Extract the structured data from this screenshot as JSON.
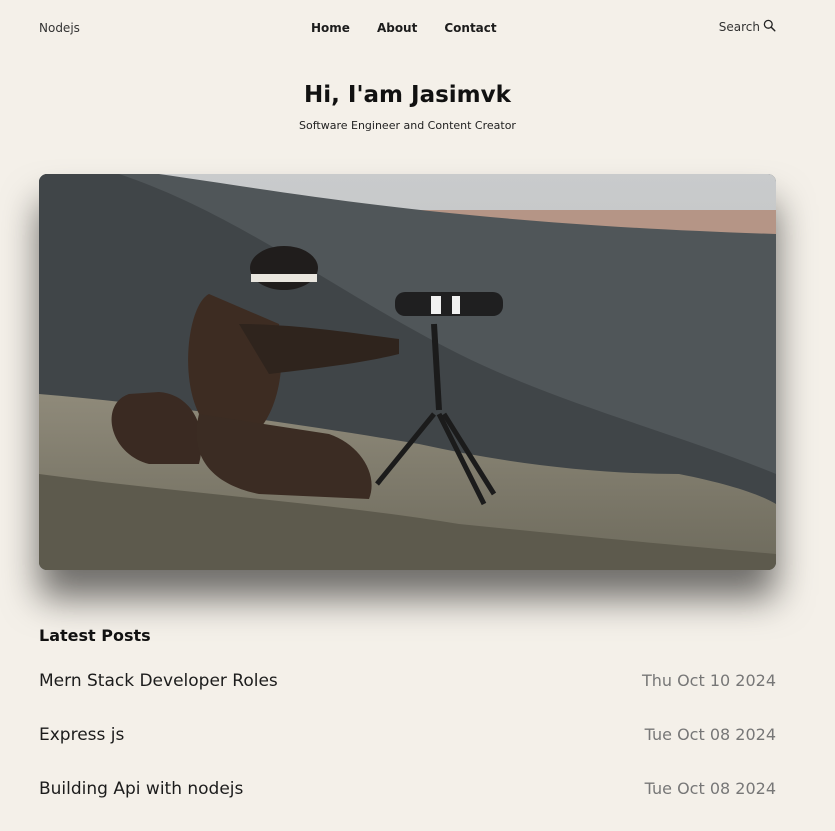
{
  "nav": {
    "logo": "Nodejs",
    "links": [
      "Home",
      "About",
      "Contact"
    ],
    "search_label": "Search"
  },
  "hero": {
    "title": "Hi, I'am Jasimvk",
    "subtitle": "Software Engineer and Content Creator"
  },
  "latest": {
    "heading": "Latest Posts",
    "posts": [
      {
        "title": "Mern Stack Developer Roles",
        "date": "Thu Oct 10 2024"
      },
      {
        "title": "Express js",
        "date": "Tue Oct 08 2024"
      },
      {
        "title": "Building Api with nodejs",
        "date": "Tue Oct 08 2024"
      }
    ]
  },
  "colors": {
    "background": "#f4f0e9",
    "text": "#1c1c1c",
    "muted": "#777777"
  },
  "icons": {
    "search": "search-icon"
  }
}
